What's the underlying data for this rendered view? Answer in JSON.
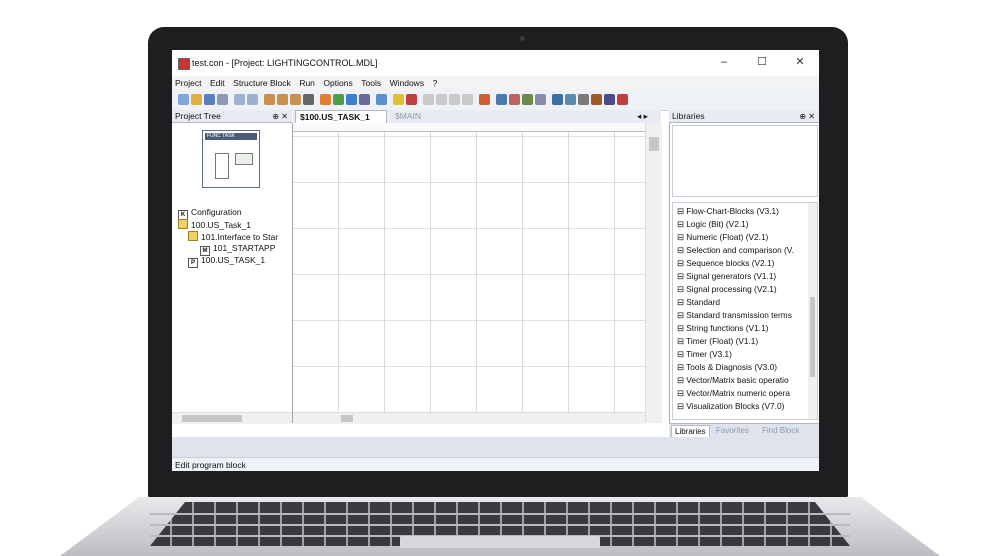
{
  "window": {
    "title": "test.con - [Project: LIGHTINGCONTROL.MDL]",
    "min_glyph": "–",
    "max_glyph": "☐",
    "close_glyph": "✕"
  },
  "menu": [
    "Project",
    "Edit",
    "Structure Block",
    "Run",
    "Options",
    "Tools",
    "Windows",
    "?"
  ],
  "project_tree": {
    "header": "Project Tree",
    "pin": "⊕ ✕",
    "preview_label": "FUNC TASK",
    "items": [
      {
        "icon": "K",
        "label": "Configuration"
      },
      {
        "icon": "",
        "label": "100.US_Task_1"
      },
      {
        "icon": "",
        "label": "101.Interface to Star"
      },
      {
        "icon": "M",
        "label": "101_STARTAPP"
      },
      {
        "icon": "P",
        "label": "100.US_TASK_1"
      }
    ]
  },
  "tabs": [
    {
      "label": "$100.US_TASK_1",
      "close": "✕"
    },
    {
      "label": "$MAIN"
    }
  ],
  "tabs_arrows": "◂ ▸",
  "libraries": {
    "header": "Libraries",
    "pin": "⊕ ✕",
    "items": [
      "Flow-Chart-Blocks (V3.1)",
      "Logic (Bit) (V2.1)",
      "Numeric (Float) (V2.1)",
      "Selection and comparison (V.",
      "Sequence blocks (V2.1)",
      "Signal generators (V1.1)",
      "Signal processing (V2.1)",
      "Standard",
      "Standard transmission terms",
      "String functions (V1.1)",
      "Timer (Float) (V1.1)",
      "Timer (V3.1)",
      "Tools & Diagnosis (V3.0)",
      "Vector/Matrix basic operatio",
      "Vector/Matrix numeric opera",
      "Visualization Blocks (V7.0)"
    ],
    "bottom_tabs": [
      "Libraries",
      "Favorites",
      "Find Block"
    ]
  },
  "status": "Edit program block",
  "colors": {
    "accent": "#3a6ea5",
    "tab_active": "#ffffff",
    "lib_bullet": "#1f4f8f"
  }
}
